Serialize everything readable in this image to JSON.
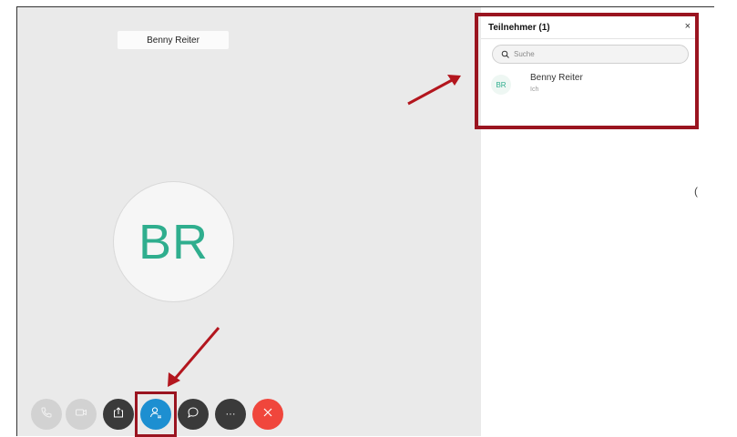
{
  "meeting": {
    "speaker_name": "Benny Reiter",
    "avatar_initials": "BR"
  },
  "panel": {
    "title": "Teilnehmer (1)",
    "close_glyph": "×",
    "search_placeholder": "Suche",
    "participants": [
      {
        "initials": "BR",
        "name": "Benny Reiter",
        "subtitle": "Ich"
      }
    ]
  },
  "controls": [
    {
      "name": "audio-button",
      "icon": "phone-icon",
      "state": "disabled"
    },
    {
      "name": "video-button",
      "icon": "camera-icon",
      "state": "disabled"
    },
    {
      "name": "share-button",
      "icon": "share-icon",
      "state": "normal"
    },
    {
      "name": "participants-button",
      "icon": "participants-icon",
      "state": "active"
    },
    {
      "name": "chat-button",
      "icon": "chat-icon",
      "state": "normal"
    },
    {
      "name": "more-button",
      "icon": "more-icon",
      "glyph": "···",
      "state": "normal"
    },
    {
      "name": "leave-button",
      "icon": "close-icon",
      "state": "danger"
    }
  ],
  "colors": {
    "accent_blue": "#1d8fd1",
    "danger_red": "#f0463c",
    "avatar_green": "#2fae8e",
    "annotation_red": "#9a1420"
  },
  "edge_glyph": "("
}
